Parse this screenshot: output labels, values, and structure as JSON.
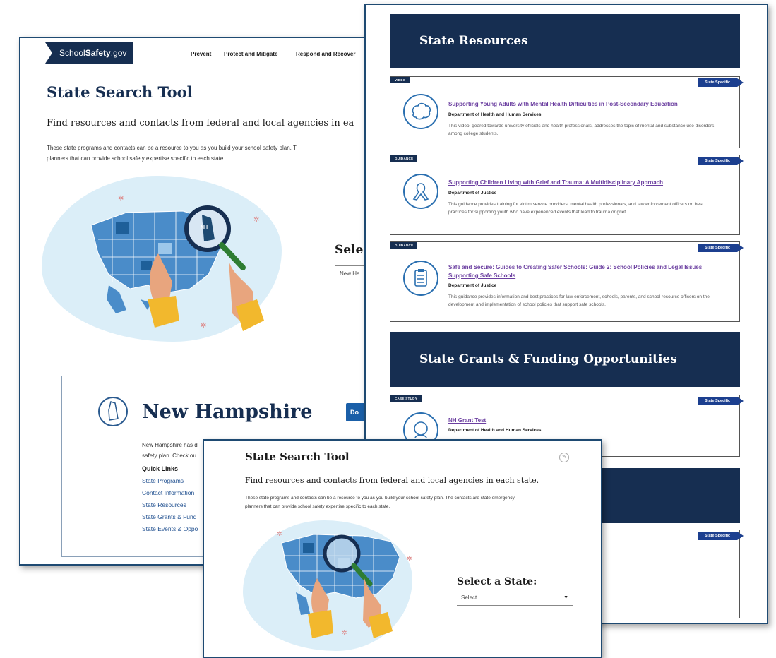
{
  "back_page": {
    "logo": {
      "pre": "School",
      "bold": "Safety",
      "post": ".gov"
    },
    "nav": [
      "Prevent",
      "Protect and Mitigate",
      "Respond and Recover"
    ],
    "title": "State Search Tool",
    "subtitle": "Find resources and contacts from federal and local agencies in ea",
    "body_line1": "These state programs and contacts can be a resource to you as you build your school safety plan. T",
    "body_line2": "planners that can provide school safety expertise specific to each state.",
    "select_heading": "Sele",
    "select_value": "New Ha",
    "map_badge": "NH",
    "state_name": "New Hampshire",
    "download_label": "Do",
    "state_text_line1": "New Hampshire has d",
    "state_text_line2": "safety plan. Check ou",
    "quick_links_heading": "Quick Links",
    "quick_links": [
      "State Programs",
      "Contact Information",
      "State Resources",
      "State Grants & Fund",
      "State Events & Oppo"
    ]
  },
  "right_page": {
    "banner_resources": "State Resources",
    "banner_grants": "State Grants & Funding Opportunities",
    "state_specific_label": "State Specific",
    "cards": [
      {
        "type": "VIDEO",
        "icon": "brain-icon",
        "title": "Supporting Young Adults with Mental Health Difficulties in Post-Secondary Education",
        "dept": "Department of Health and Human Services",
        "desc": "This video, geared towards university officials and health professionals, addresses the topic of mental and substance use disorders among college students."
      },
      {
        "type": "GUIDANCE",
        "icon": "ribbon-icon",
        "title": "Supporting Children Living with Grief and Trauma: A Multidisciplinary Approach",
        "dept": "Department of Justice",
        "desc": "This guidance provides training for victim service providers, mental health professionals, and law enforcement officers on best practices for supporting youth who have experienced events that lead to trauma or grief."
      },
      {
        "type": "GUIDANCE",
        "icon": "clipboard-icon",
        "title": "Safe and Secure: Guides to Creating Safer Schools: Guide 2: School Policies and Legal Issues Supporting Safe Schools",
        "dept": "Department of Justice",
        "desc": "This guidance provides information and best practices for law enforcement, schools, parents, and school resource officers on the development and implementation of school policies that support safe schools."
      },
      {
        "type": "CASE STUDY",
        "icon": "head-icon",
        "title": "NH Grant Test",
        "dept": "Department of Health and Human Services",
        "desc": ""
      }
    ]
  },
  "front_page": {
    "title": "State Search Tool",
    "subtitle": "Find resources and contacts from federal and local agencies in each state.",
    "body_line1": "These state programs and contacts can be a resource to you as you build your school safety plan. The contacts are state emergency",
    "body_line2": "planners that can provide school safety expertise specific to each state.",
    "select_heading": "Select a State:",
    "select_value": "Select",
    "select_arrow": "▼",
    "edit_icon": "✎"
  },
  "colors": {
    "navy": "#162e51",
    "link": "#1f4f8f",
    "visited": "#6b3fa0",
    "map_light": "#dbeef8",
    "map_state": "#4a8cc9"
  }
}
